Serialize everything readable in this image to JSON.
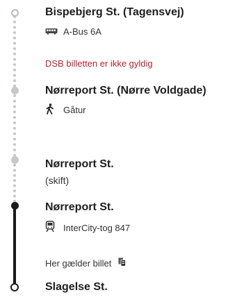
{
  "stops": [
    {
      "name": "Bispebjerg St. (Tagensvej)"
    },
    {
      "name": "Nørreport St. (Nørre Voldgade)"
    },
    {
      "name": "Nørreport St."
    },
    {
      "name": "Nørreport St."
    },
    {
      "name": "Slagelse St."
    }
  ],
  "legs": {
    "bus": {
      "label": "A-Bus 6A",
      "icon": "bus-icon"
    },
    "walk": {
      "label": "Gåtur",
      "icon": "walking-person-icon"
    },
    "train": {
      "label": "InterCity-tog 847",
      "icon": "train-icon"
    }
  },
  "notices": {
    "invalid_ticket": "DSB billetten er ikke gyldig",
    "ticket_valid": "Her gælder billet",
    "transfer": "(skift)"
  },
  "colors": {
    "warning_text": "#b8232f",
    "dotted_line": "#c4c7c9",
    "solid_line": "#1a1a1a"
  }
}
